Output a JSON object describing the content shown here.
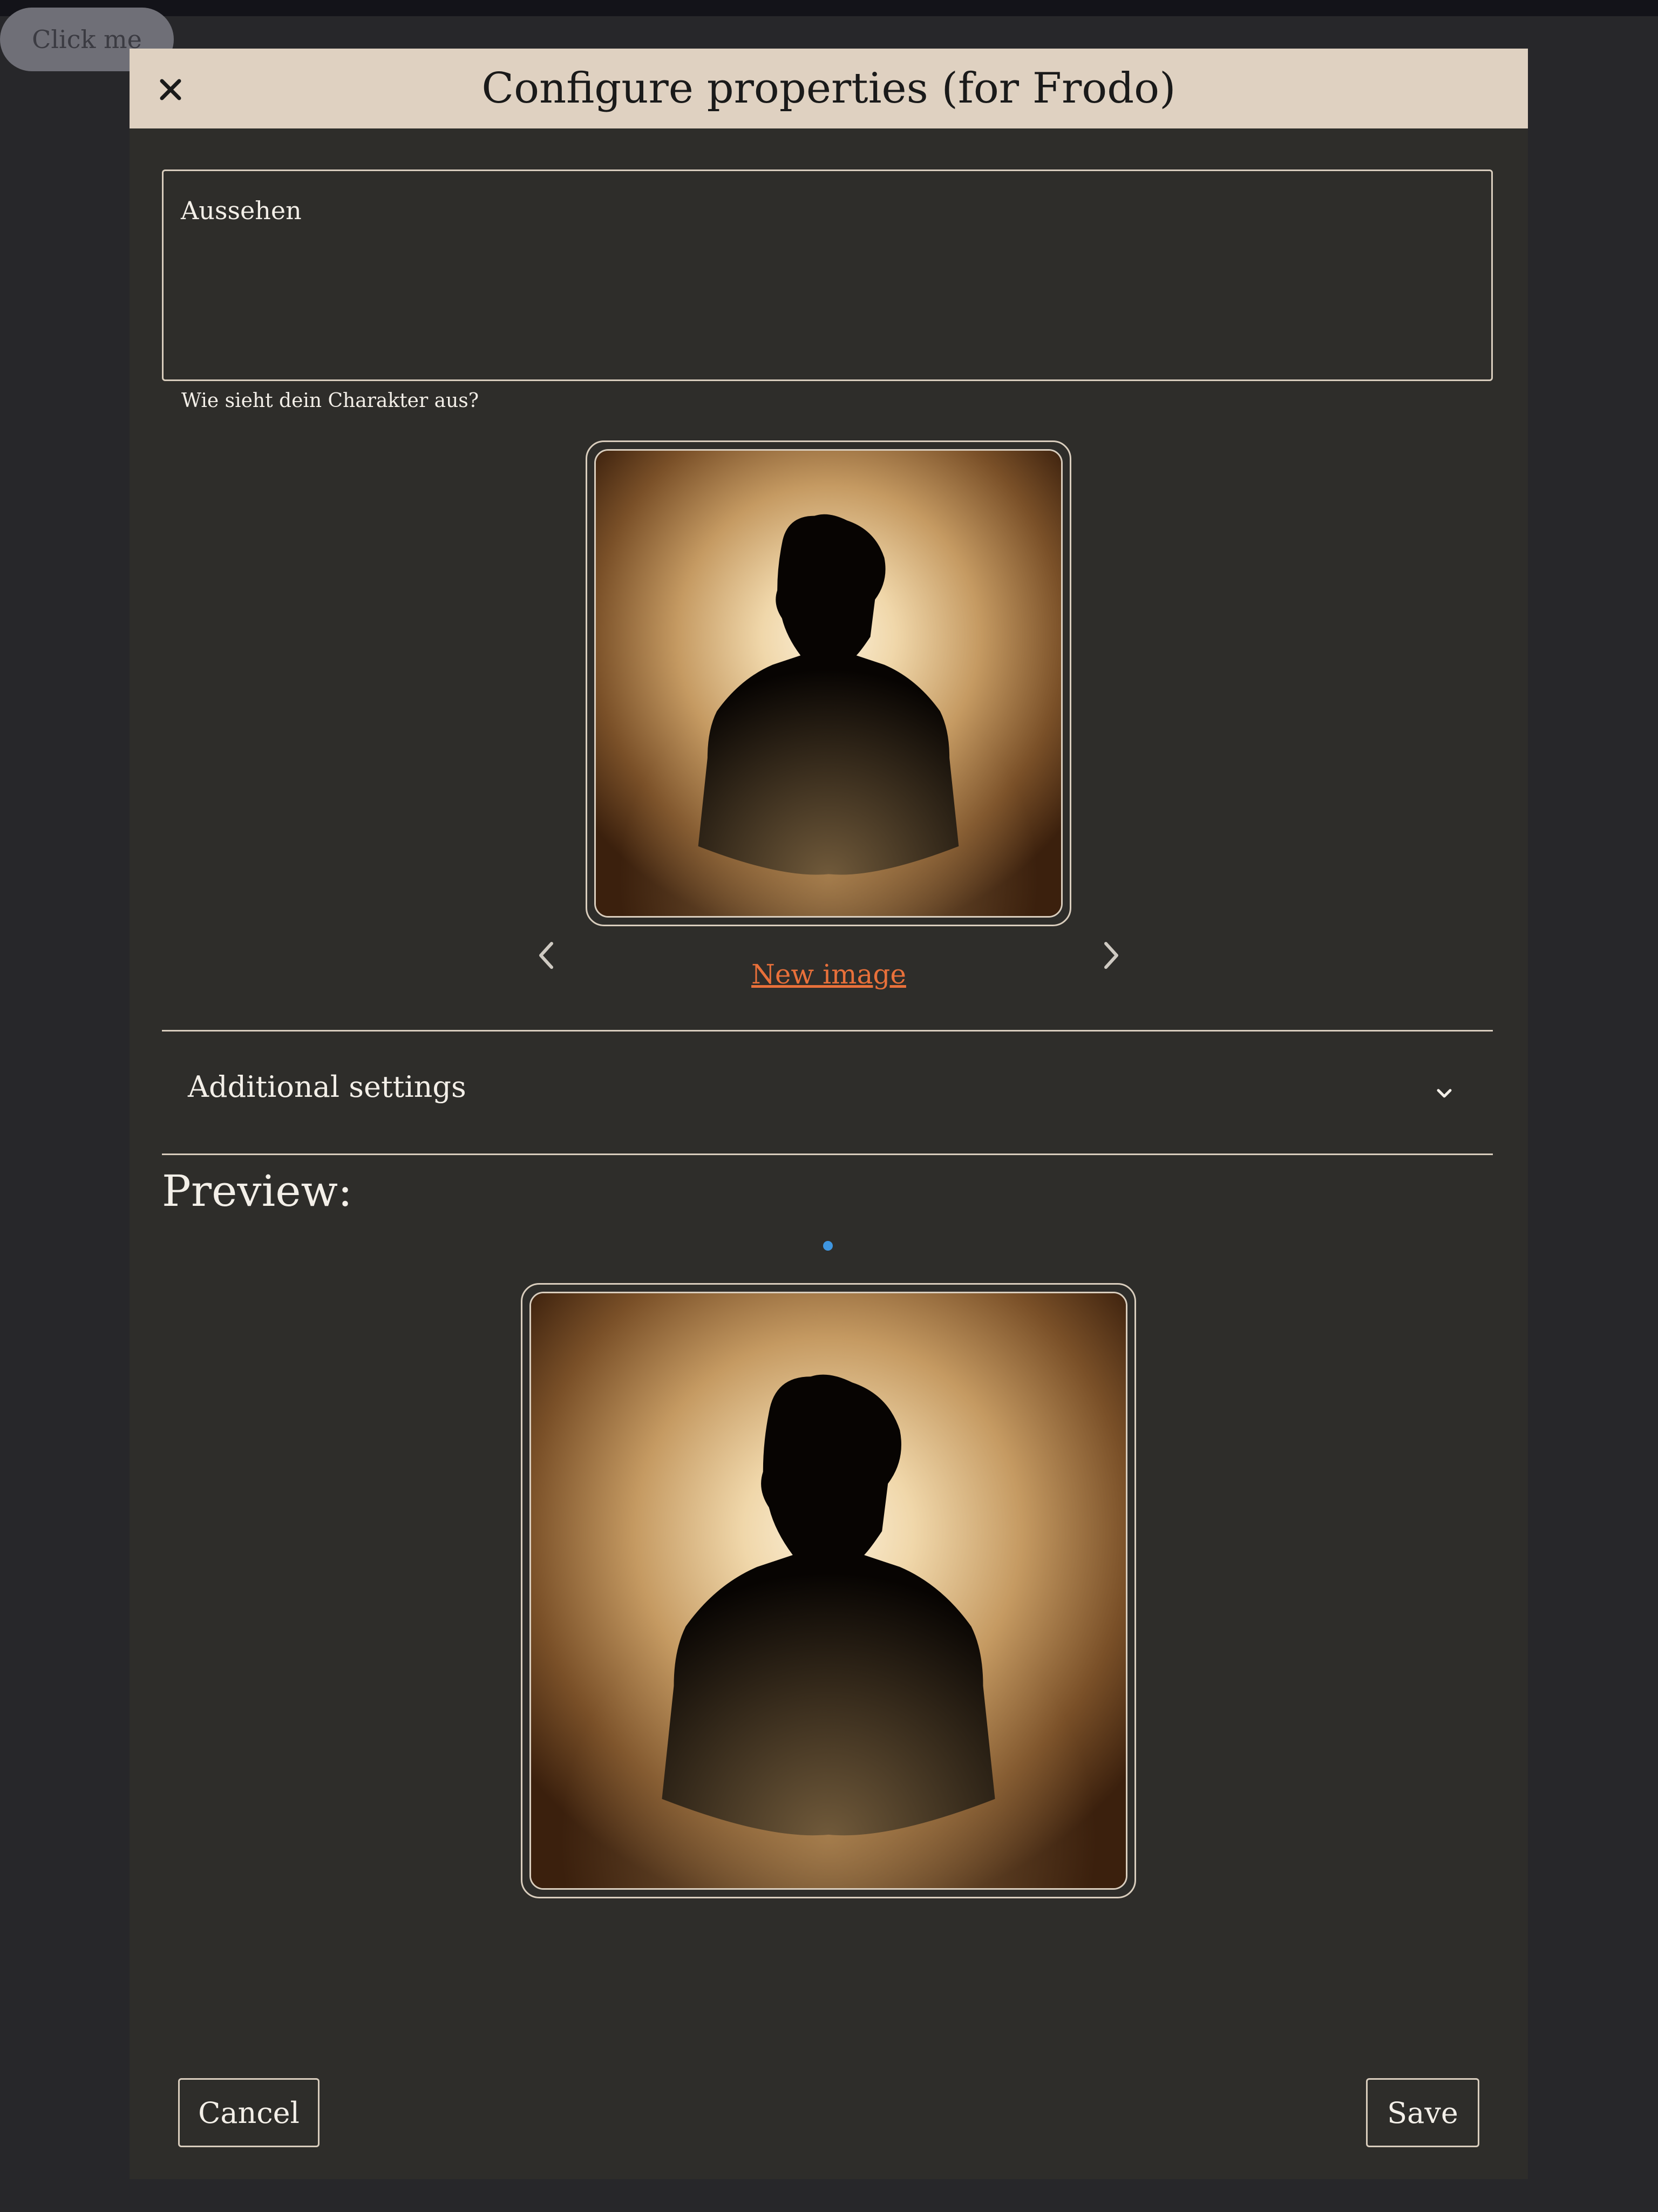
{
  "background_button": {
    "label": "Click me"
  },
  "modal": {
    "title": "Configure properties (for Frodo)",
    "close_icon": "close-icon",
    "textarea": {
      "label": "Aussehen",
      "helper": "Wie sieht dein Charakter aus?"
    },
    "image_selector": {
      "prev_icon": "chevron-left-icon",
      "next_icon": "chevron-right-icon",
      "new_image_label": "New image"
    },
    "additional_settings": {
      "label": "Additional settings",
      "icon": "chevron-down-icon"
    },
    "preview": {
      "heading": "Preview:"
    },
    "footer": {
      "cancel_label": "Cancel",
      "save_label": "Save"
    }
  },
  "colors": {
    "page_background": "#27272a",
    "modal_background": "#2e2d2a",
    "header_background": "#dfd1c1",
    "border": "#d9cdbd",
    "link": "#e8703a",
    "indicator": "#3f96e0"
  }
}
